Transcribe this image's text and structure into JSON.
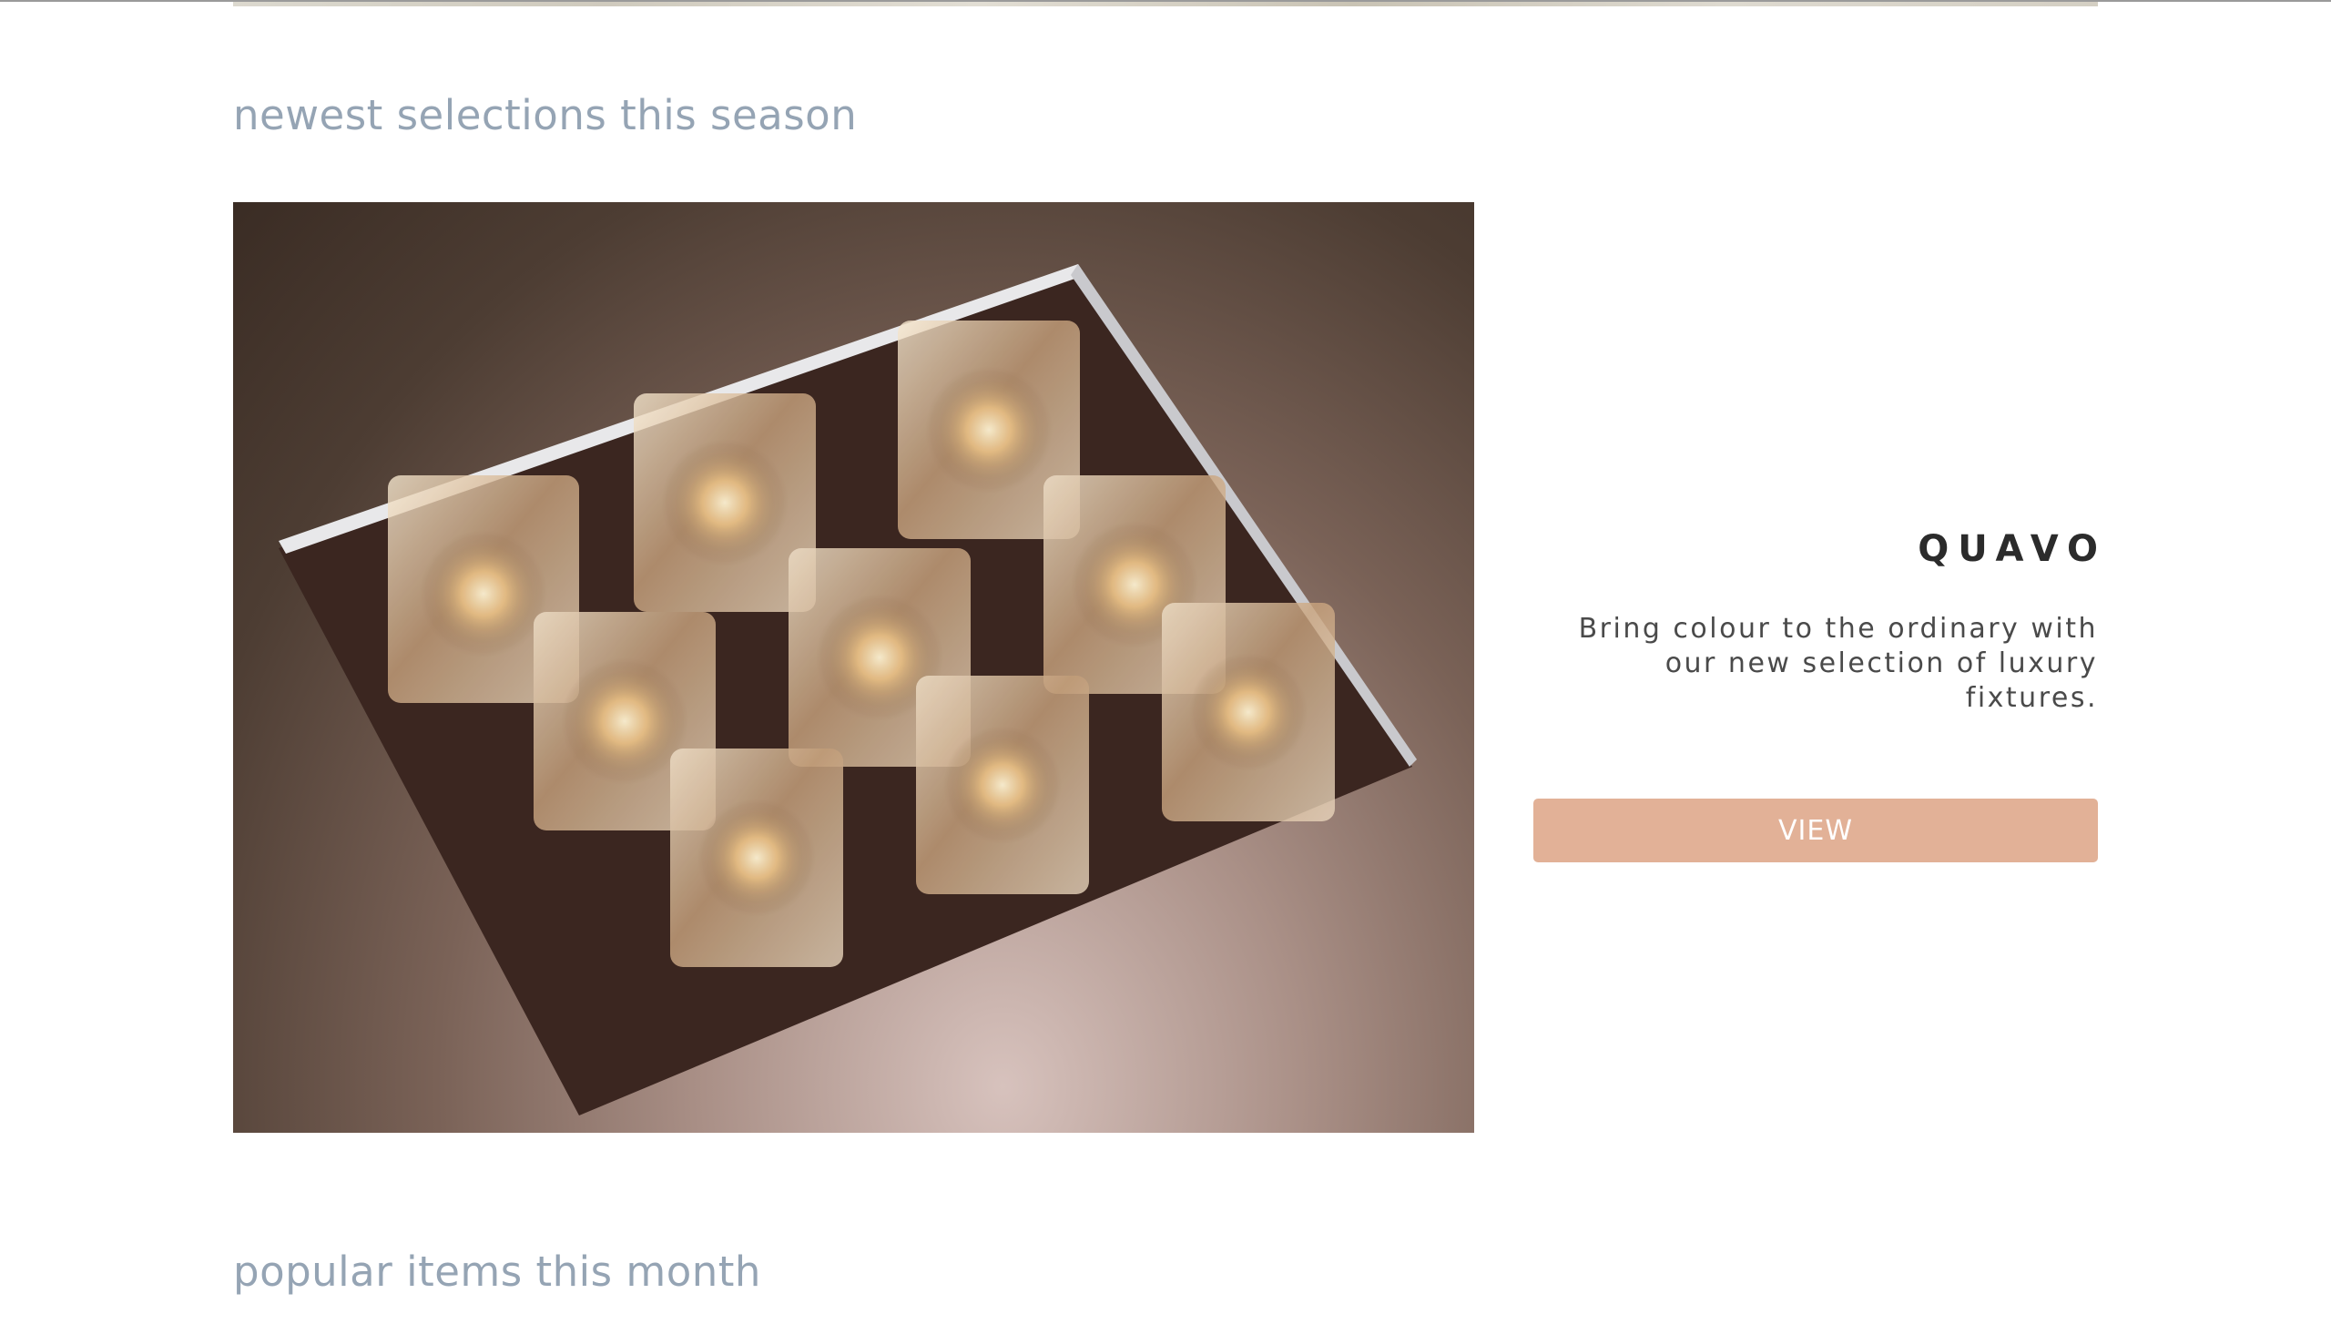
{
  "sections": {
    "newest": {
      "heading": "newest selections this season"
    },
    "popular": {
      "heading": "popular items this month"
    }
  },
  "feature": {
    "image_alt": "crystal cube ceiling light",
    "product_name": "QUAVO",
    "description": "Bring colour to the ordinary with our new selection of luxury fixtures.",
    "button_label": "VIEW"
  },
  "colors": {
    "heading": "#95a4b4",
    "button": "#e2b197",
    "button_text": "#ffffff",
    "product_name": "#2b2b2b",
    "description": "#4a4a4a"
  }
}
